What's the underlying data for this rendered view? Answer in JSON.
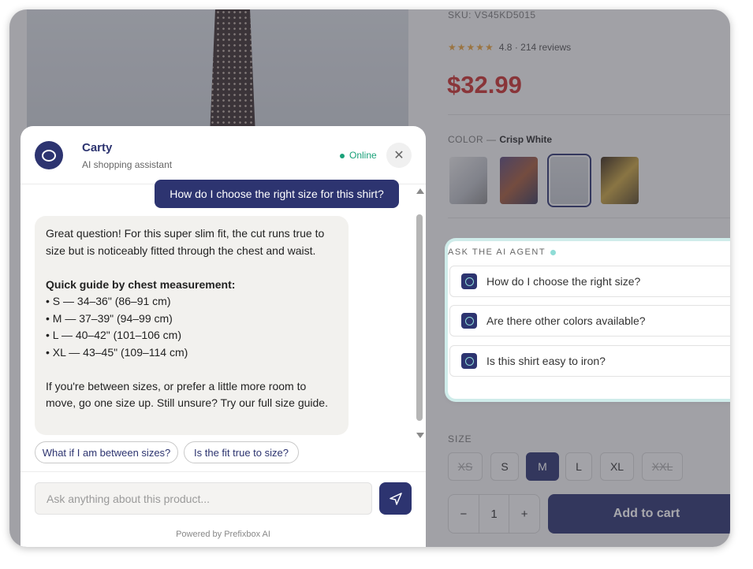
{
  "product": {
    "sku": "SKU: VS45KD5015",
    "stars": "★★★★★",
    "rating": "4.8 · 214 reviews",
    "price": "$32.99",
    "color_label": "COLOR —",
    "color_value": "Crisp White",
    "swatches": [
      "white-shirt-model",
      "folded-shirts",
      "white-shirt-tie",
      "plaid-shirt-model"
    ],
    "selected_swatch_index": 2
  },
  "ai_agent": {
    "title": "ASK THE AI AGENT",
    "questions": [
      "How do I choose the right size?",
      "Are there other colors available?",
      "Is this shirt easy to iron?"
    ]
  },
  "size": {
    "label": "SIZE",
    "options": [
      "XS",
      "S",
      "M",
      "L",
      "XL",
      "XXL"
    ],
    "selected": "M",
    "unavailable": [
      "XS",
      "XXL"
    ]
  },
  "quantity": {
    "minus": "−",
    "value": "1",
    "plus": "+"
  },
  "add_to_cart": "Add to cart",
  "chat": {
    "bot_name": "Carty",
    "bot_subtitle": "AI shopping assistant",
    "status": "Online",
    "close": "✕",
    "user_message": "How do I choose the right size for this shirt?",
    "bot_intro": "Great question! For this super slim fit, the cut runs true to size but is noticeably fitted through the chest and waist.",
    "guide_title": "Quick guide by chest measurement:",
    "guide_items": [
      "• S — 34–36\" (86–91 cm)",
      "• M — 37–39\" (94–99 cm)",
      "• L — 40–42\" (101–106 cm)",
      "• XL — 43–45\" (109–114 cm)"
    ],
    "bot_outro": "If you're between sizes, or prefer a little more room to move, go one size up. Still unsure? Try our full size guide.",
    "suggestions": [
      "What if I am between sizes?",
      "Is the fit true to size?"
    ],
    "input_placeholder": "Ask anything about this product...",
    "powered_by": "Powered by Prefixbox AI"
  },
  "colors": {
    "brand": "#2d3470",
    "price": "#c8312f",
    "online": "#1aa179",
    "accent": "#8fdcd6"
  }
}
